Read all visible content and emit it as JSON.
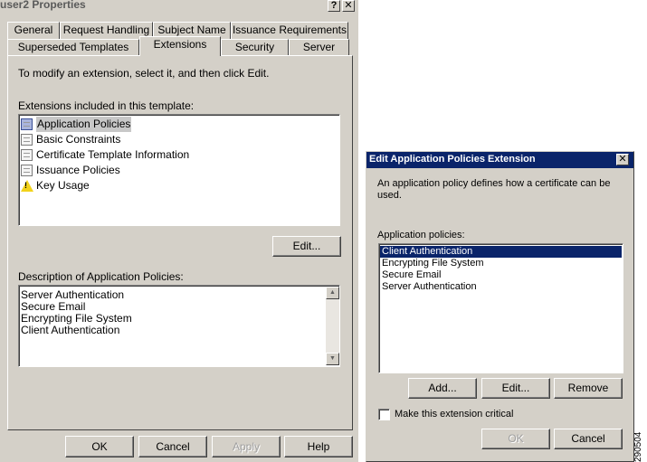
{
  "main_dialog": {
    "title": "user2 Properties",
    "help_btn": "?",
    "close_btn": "✕",
    "tabs_row1": [
      "General",
      "Request Handling",
      "Subject Name",
      "Issuance Requirements"
    ],
    "tabs_row2": [
      "Superseded Templates",
      "Extensions",
      "Security",
      "Server"
    ],
    "active_tab": "Extensions",
    "instruction": "To modify an extension, select it, and then click Edit.",
    "extensions_label": "Extensions included in this template:",
    "extensions": [
      {
        "label": "Application Policies",
        "icon": "document-icon",
        "selected": true
      },
      {
        "label": "Basic Constraints",
        "icon": "document-icon",
        "selected": false
      },
      {
        "label": "Certificate Template Information",
        "icon": "document-icon",
        "selected": false
      },
      {
        "label": "Issuance Policies",
        "icon": "document-icon",
        "selected": false
      },
      {
        "label": "Key Usage",
        "icon": "warning-icon",
        "selected": false
      }
    ],
    "edit_btn": "Edit...",
    "description_label": "Description of Application Policies:",
    "description_lines": [
      "Server Authentication",
      "Secure Email",
      "Encrypting File System",
      "Client Authentication"
    ],
    "footer": {
      "ok": "OK",
      "cancel": "Cancel",
      "apply": "Apply",
      "help": "Help"
    }
  },
  "edit_dialog": {
    "title": "Edit Application Policies Extension",
    "close_btn": "✕",
    "intro": "An application policy defines how a certificate can be used.",
    "policies_label": "Application policies:",
    "policies": [
      {
        "label": "Client Authentication",
        "selected": true
      },
      {
        "label": "Encrypting File System",
        "selected": false
      },
      {
        "label": "Secure Email",
        "selected": false
      },
      {
        "label": "Server Authentication",
        "selected": false
      }
    ],
    "buttons": {
      "add": "Add...",
      "edit": "Edit...",
      "remove": "Remove"
    },
    "critical_label": "Make this extension critical",
    "critical_checked": false,
    "ok": "OK",
    "cancel": "Cancel"
  },
  "figure_number": "290504"
}
